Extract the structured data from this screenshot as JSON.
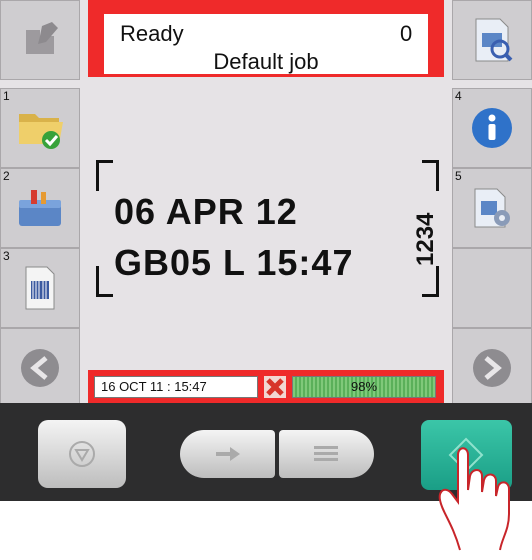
{
  "status_bar": {
    "state": "Ready",
    "count": "0",
    "job": "Default job"
  },
  "side_numbers": {
    "one": "1",
    "two": "2",
    "three": "3",
    "four": "4",
    "five": "5"
  },
  "message": {
    "line1": "06 APR 12",
    "line2": "GB05 L 15:47",
    "vertical": "1234"
  },
  "footer": {
    "datetime": "16 OCT 11 : 15:47",
    "ink_level": "98%",
    "ink_fraction": 0.98
  },
  "icons": {
    "top_left": "pencil-icon",
    "top_right": "job-preview-icon",
    "left_1": "folder-check-icon",
    "left_2": "toolbox-icon",
    "left_3": "barcode-document-icon",
    "right_4": "info-icon",
    "right_5": "settings-document-icon",
    "nav_left": "arrow-left-icon",
    "nav_right": "arrow-right-icon",
    "fault": "fault-x-icon",
    "stop": "stop-icon",
    "enter": "enter-icon",
    "menu": "menu-icon",
    "start": "start-icon"
  },
  "colors": {
    "status_frame": "#ef2a2a",
    "start_button": "#26b49a",
    "ink_bar": "#6fbf6a"
  }
}
